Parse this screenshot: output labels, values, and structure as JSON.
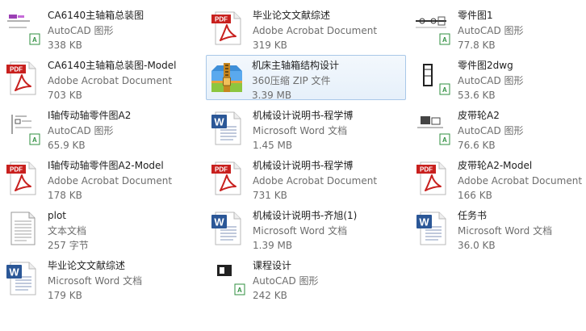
{
  "files": [
    {
      "name": "CA6140主轴箱总装图",
      "type": "AutoCAD 图形",
      "size": "338 KB",
      "icon": "autocad-drawing-icon",
      "selected": false
    },
    {
      "name": "CA6140主轴箱总装图-Model",
      "type": "Adobe Acrobat Document",
      "size": "703 KB",
      "icon": "pdf-icon",
      "selected": false
    },
    {
      "name": "I轴传动轴零件图A2",
      "type": "AutoCAD 图形",
      "size": "65.9 KB",
      "icon": "autocad-drawing-icon",
      "selected": false
    },
    {
      "name": "I轴传动轴零件图A2-Model",
      "type": "Adobe Acrobat Document",
      "size": "178 KB",
      "icon": "pdf-icon",
      "selected": false
    },
    {
      "name": "plot",
      "type": "文本文档",
      "size": "257 字节",
      "icon": "text-document-icon",
      "selected": false
    },
    {
      "name": "毕业论文文献综述",
      "type": "Microsoft Word 文档",
      "size": "179 KB",
      "icon": "word-document-icon",
      "selected": false
    },
    {
      "name": "毕业论文文献综述",
      "type": "Adobe Acrobat Document",
      "size": "319 KB",
      "icon": "pdf-icon",
      "selected": false
    },
    {
      "name": "机床主轴箱结构设计",
      "type": "360压缩 ZIP 文件",
      "size": "3.39 MB",
      "icon": "zip-archive-icon",
      "selected": true
    },
    {
      "name": "机械设计说明书-程学博",
      "type": "Microsoft Word 文档",
      "size": "1.45 MB",
      "icon": "word-document-icon",
      "selected": false
    },
    {
      "name": "机械设计说明书-程学博",
      "type": "Adobe Acrobat Document",
      "size": "731 KB",
      "icon": "pdf-icon",
      "selected": false
    },
    {
      "name": "机械设计说明书-齐旭(1)",
      "type": "Microsoft Word 文档",
      "size": "1.39 MB",
      "icon": "word-document-icon",
      "selected": false
    },
    {
      "name": "课程设计",
      "type": "AutoCAD 图形",
      "size": "242 KB",
      "icon": "autocad-drawing-icon",
      "selected": false
    },
    {
      "name": "零件图1",
      "type": "AutoCAD 图形",
      "size": "77.8 KB",
      "icon": "autocad-drawing-icon",
      "selected": false
    },
    {
      "name": "零件图2dwg",
      "type": "AutoCAD 图形",
      "size": "53.6 KB",
      "icon": "autocad-drawing-icon",
      "selected": false
    },
    {
      "name": "皮带轮A2",
      "type": "AutoCAD 图形",
      "size": "76.6 KB",
      "icon": "autocad-drawing-icon",
      "selected": false
    },
    {
      "name": "皮带轮A2-Model",
      "type": "Adobe Acrobat Document",
      "size": "166 KB",
      "icon": "pdf-icon",
      "selected": false
    },
    {
      "name": "任务书",
      "type": "Microsoft Word 文档",
      "size": "36.0 KB",
      "icon": "word-document-icon",
      "selected": false
    }
  ],
  "icon_labels": {
    "pdf": "PDF",
    "word": "W"
  },
  "colors": {
    "pdf_red": "#c8201e",
    "word_blue": "#2b5797",
    "selection_border": "#a9c8e8",
    "cad_green": "#2f8f3f"
  }
}
